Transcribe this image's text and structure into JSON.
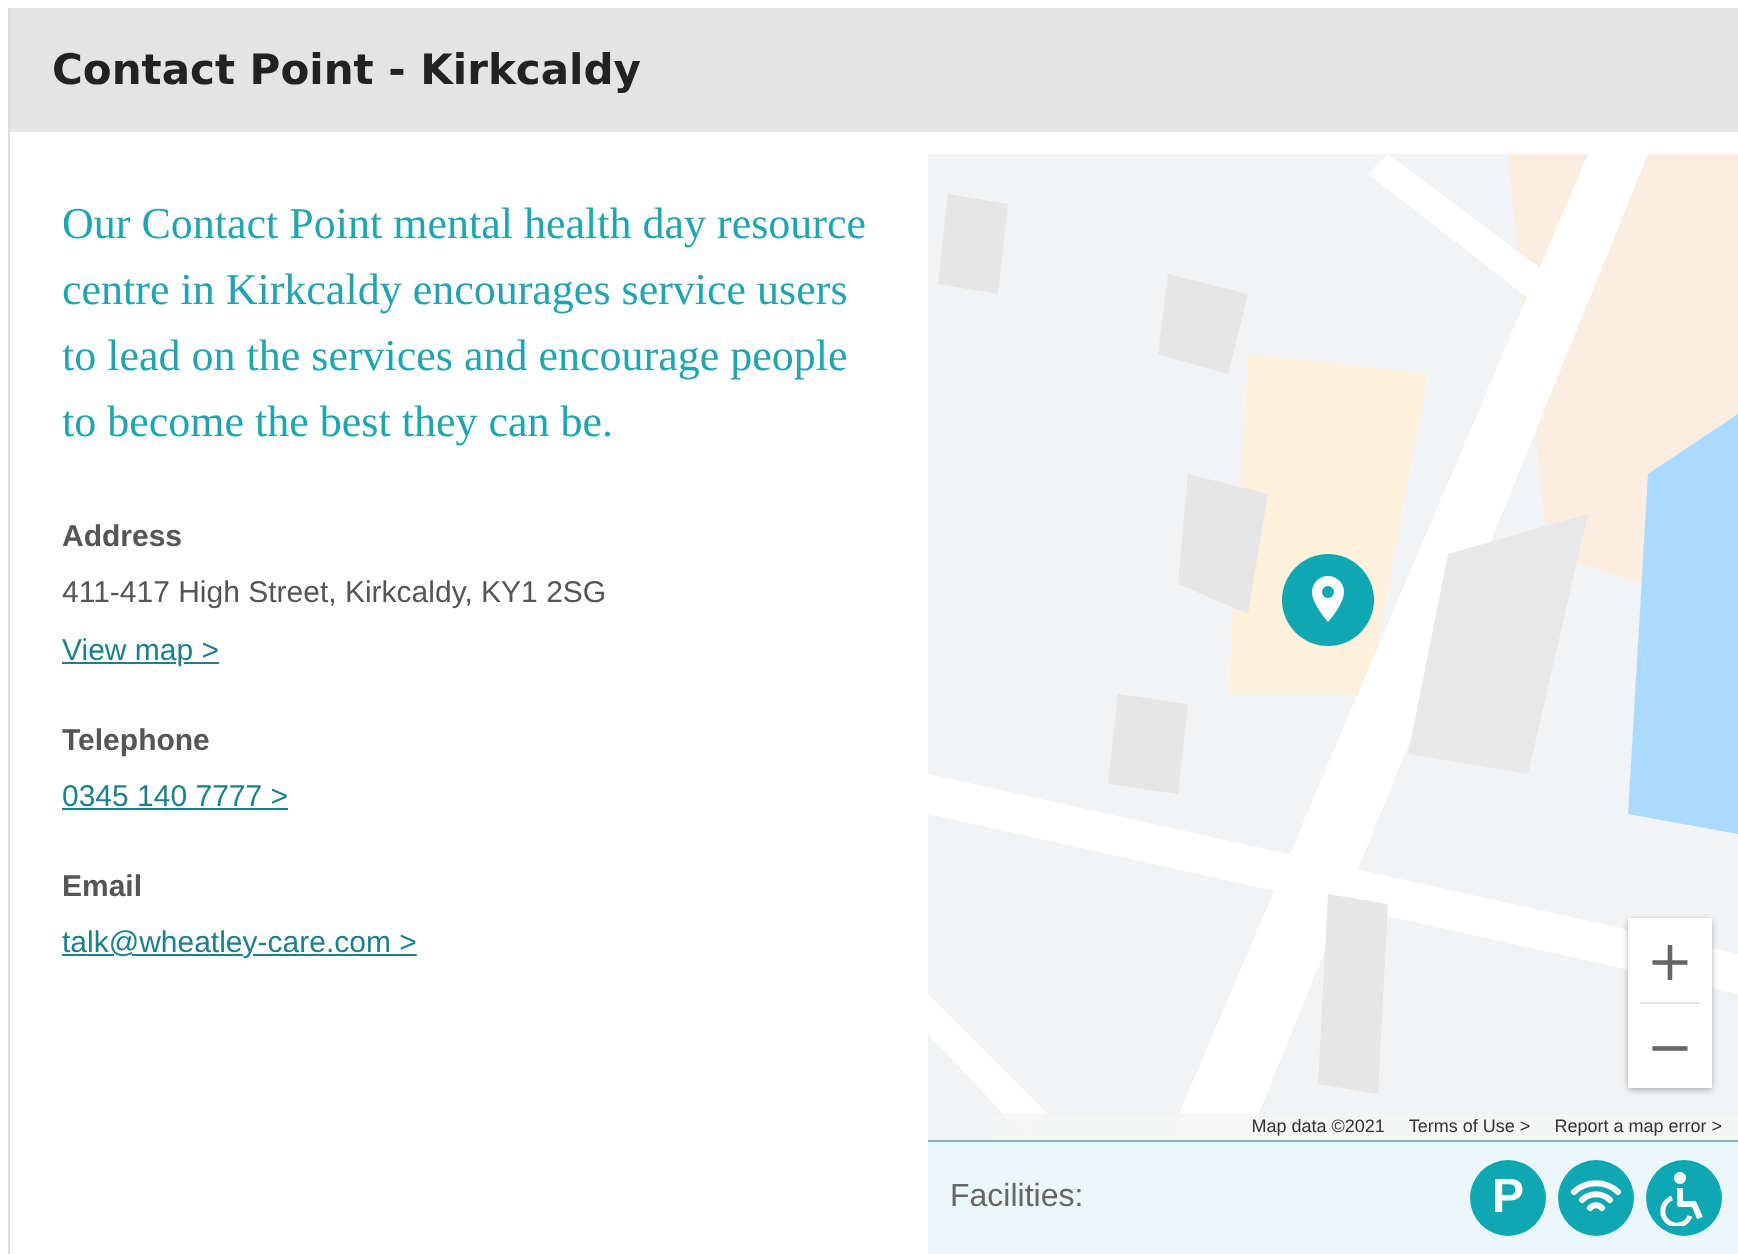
{
  "header": {
    "title": "Contact Point - Kirkcaldy"
  },
  "intro": "Our Contact Point mental health day resource centre in Kirkcaldy encourages service users to lead on the services and encourage people to become the best they can be.",
  "details": [
    {
      "label": "Address",
      "value": "411-417 High Street, Kirkcaldy, KY1 2SG",
      "link": "View map >"
    },
    {
      "label": "Telephone",
      "link": "0345 140 7777 >"
    },
    {
      "label": "Email",
      "link": "talk@wheatley-care.com >"
    }
  ],
  "map": {
    "kind": "picture",
    "zoom_in": "+",
    "zoom_out": "−",
    "attribution": [
      "Map data ©2021",
      "Terms of Use >",
      "Report a map error >"
    ]
  },
  "facilities": {
    "label": "Facilities:",
    "items": [
      {
        "kind": "parking",
        "symbol": "P"
      },
      {
        "kind": "wifi"
      },
      {
        "kind": "accessible"
      }
    ]
  }
}
